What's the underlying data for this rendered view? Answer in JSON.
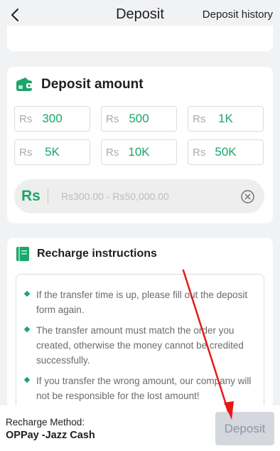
{
  "header": {
    "title": "Deposit",
    "history_label": "Deposit history"
  },
  "amount": {
    "title": "Deposit amount",
    "currency": "Rs",
    "options": [
      {
        "currency": "Rs",
        "value": "300"
      },
      {
        "currency": "Rs",
        "value": "500"
      },
      {
        "currency": "Rs",
        "value": "1K"
      },
      {
        "currency": "Rs",
        "value": "5K"
      },
      {
        "currency": "Rs",
        "value": "10K"
      },
      {
        "currency": "Rs",
        "value": "50K"
      }
    ],
    "input_prefix": "Rs",
    "input_placeholder": "Rs300.00 - Rs50,000.00"
  },
  "instructions": {
    "title": "Recharge instructions",
    "items": [
      "If the transfer time is up, please fill out the deposit form again.",
      "The transfer amount must match the order you created, otherwise the money cannot be credited successfully.",
      "If you transfer the wrong amount, our company will not be responsible for the lost amount!"
    ]
  },
  "footer": {
    "method_label": "Recharge Method:",
    "method_value": "OPPay -Jazz Cash",
    "deposit_label": "Deposit"
  },
  "colors": {
    "accent": "#1ba66a",
    "annotation_arrow": "#e81818",
    "disabled_button": "#d4d7de"
  },
  "icons": {
    "back": "chevron-left-icon",
    "wallet": "wallet-icon",
    "book": "book-icon",
    "clear": "clear-circle-icon"
  }
}
